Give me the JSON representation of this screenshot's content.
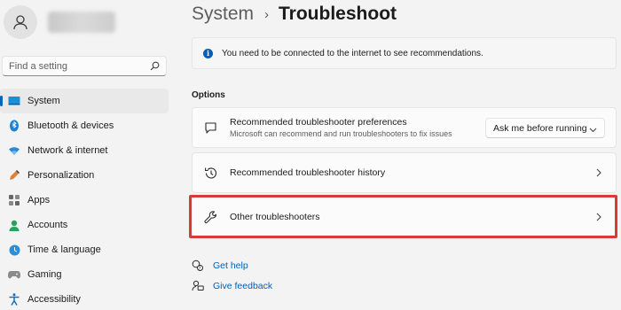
{
  "sidebar": {
    "search_placeholder": "Find a setting",
    "items": [
      {
        "label": "System",
        "active": true
      },
      {
        "label": "Bluetooth & devices"
      },
      {
        "label": "Network & internet"
      },
      {
        "label": "Personalization"
      },
      {
        "label": "Apps"
      },
      {
        "label": "Accounts"
      },
      {
        "label": "Time & language"
      },
      {
        "label": "Gaming"
      },
      {
        "label": "Accessibility"
      }
    ]
  },
  "header": {
    "parent": "System",
    "separator": "›",
    "current": "Troubleshoot"
  },
  "info": {
    "icon_glyph": "i",
    "text": "You need to be connected to the internet to see recommendations."
  },
  "options": {
    "title": "Options",
    "preferences": {
      "title": "Recommended troubleshooter preferences",
      "description": "Microsoft can recommend and run troubleshooters to fix issues",
      "dropdown_value": "Ask me before running"
    },
    "history": {
      "title": "Recommended troubleshooter history"
    },
    "other": {
      "title": "Other troubleshooters"
    }
  },
  "links": {
    "help": "Get help",
    "feedback": "Give feedback"
  },
  "colors": {
    "accent": "#005fb8",
    "highlight": "#d9383c",
    "background": "#f3f3f3"
  },
  "icons": [
    "avatar-icon",
    "search-icon",
    "system-icon",
    "bluetooth-icon",
    "network-icon",
    "personalization-icon",
    "apps-icon",
    "accounts-icon",
    "time-language-icon",
    "gaming-icon",
    "accessibility-icon",
    "info-icon",
    "message-icon",
    "history-icon",
    "wrench-icon",
    "chevron-right-icon",
    "chevron-down-icon",
    "help-icon",
    "feedback-icon"
  ]
}
